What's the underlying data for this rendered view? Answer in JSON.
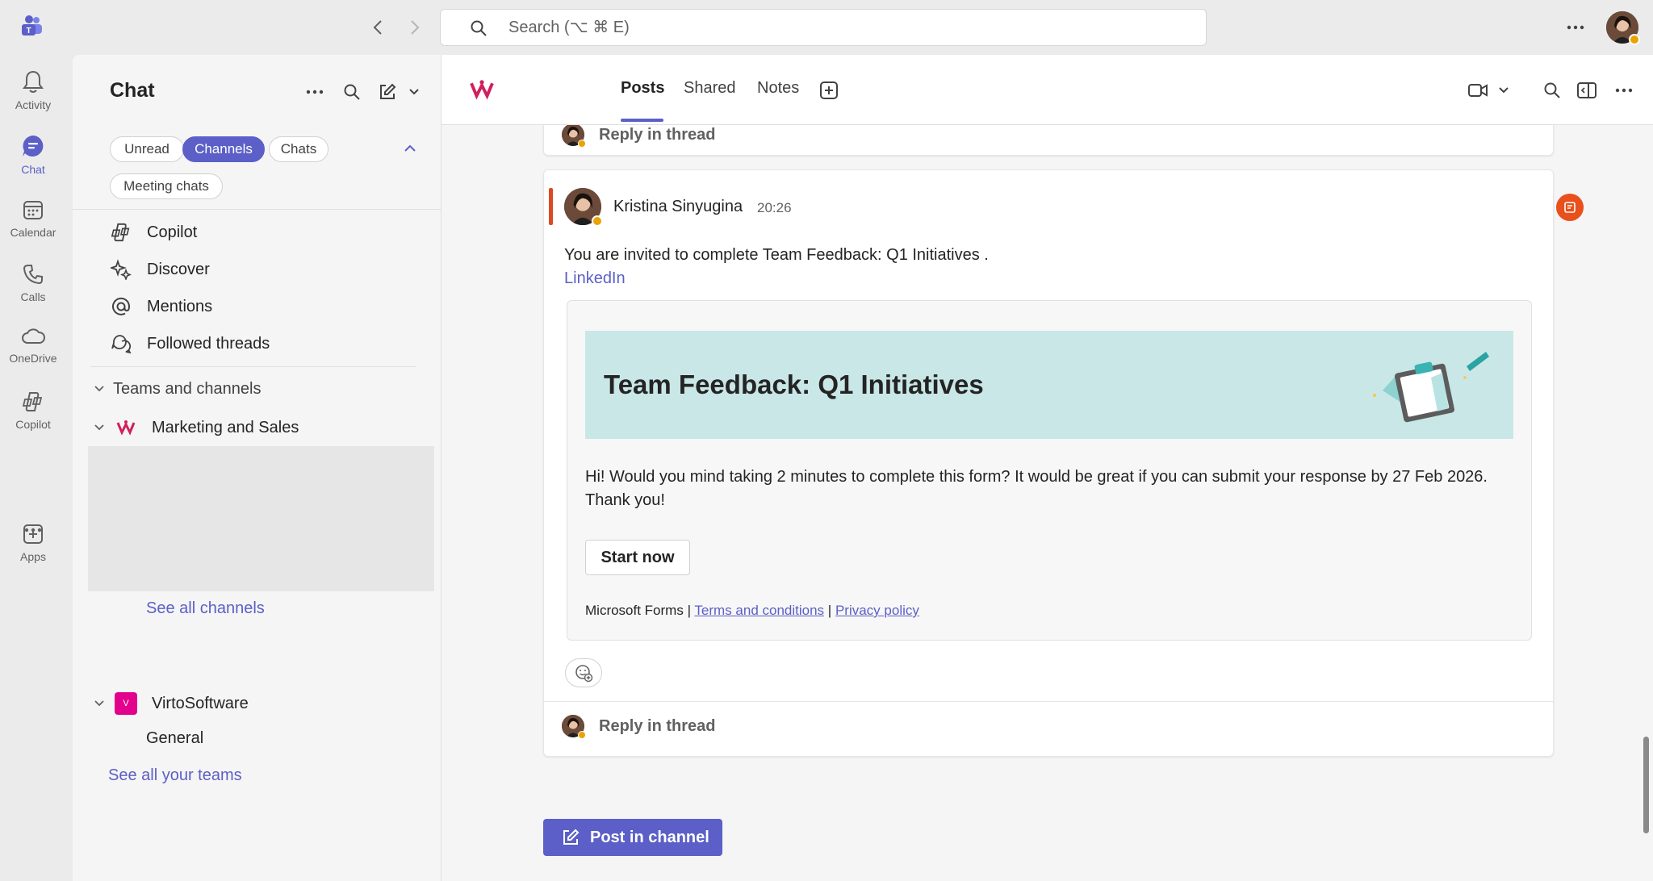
{
  "search": {
    "placeholder": "Search (⌥ ⌘ E)"
  },
  "rail": {
    "items": [
      {
        "label": "Activity"
      },
      {
        "label": "Chat"
      },
      {
        "label": "Calendar"
      },
      {
        "label": "Calls"
      },
      {
        "label": "OneDrive"
      },
      {
        "label": "Copilot"
      },
      {
        "label": "Apps"
      }
    ]
  },
  "chatpane": {
    "title": "Chat",
    "filters": [
      "Unread",
      "Channels",
      "Chats",
      "Meeting chats"
    ],
    "nav": [
      "Copilot",
      "Discover",
      "Mentions",
      "Followed threads"
    ],
    "section_label": "Teams and channels",
    "team1": {
      "name": "Marketing and Sales",
      "see_all": "See all channels"
    },
    "team2": {
      "name": "VirtoSoftware",
      "logo_letter": "V",
      "channel": "General"
    },
    "see_all_teams": "See all your teams"
  },
  "main": {
    "tabs": [
      "Posts",
      "Shared",
      "Notes"
    ],
    "reply_label": "Reply in thread",
    "post": {
      "author": "Kristina Sinyugina",
      "time": "20:26",
      "text": "You are invited to complete Team Feedback: Q1 Initiatives .",
      "link": "LinkedIn",
      "form": {
        "title": "Team Feedback: Q1 Initiatives",
        "description": "Hi! Would you mind taking 2 minutes to complete this form? It would be great if you can submit your response by 27 Feb 2026. Thank you!",
        "button": "Start now",
        "footer_brand": "Microsoft Forms",
        "separator": "|",
        "terms": "Terms and conditions",
        "privacy": "Privacy policy"
      }
    },
    "post_button": "Post in channel"
  },
  "colors": {
    "accent": "#5b5fc7",
    "urgent": "#dc4a22",
    "banner": "#c9e7e7",
    "presence": "#eaa300"
  }
}
